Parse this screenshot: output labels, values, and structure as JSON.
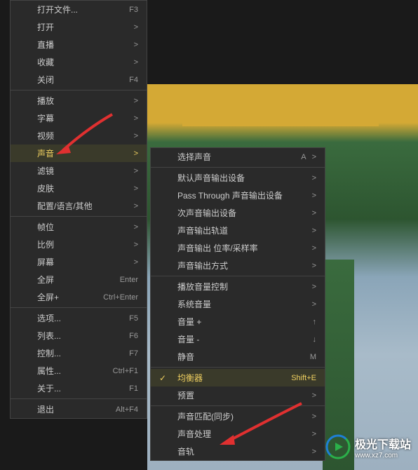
{
  "menu_left": {
    "groups": [
      [
        {
          "label": "打开文件...",
          "shortcut": "F3",
          "sub": false
        },
        {
          "label": "打开",
          "shortcut": "",
          "sub": true
        },
        {
          "label": "直播",
          "shortcut": "",
          "sub": true
        },
        {
          "label": "收藏",
          "shortcut": "",
          "sub": true
        },
        {
          "label": "关闭",
          "shortcut": "F4",
          "sub": false
        }
      ],
      [
        {
          "label": "播放",
          "shortcut": "",
          "sub": true
        },
        {
          "label": "字幕",
          "shortcut": "",
          "sub": true
        },
        {
          "label": "视频",
          "shortcut": "",
          "sub": true
        },
        {
          "label": "声音",
          "shortcut": "",
          "sub": true,
          "hl": true
        },
        {
          "label": "滤镜",
          "shortcut": "",
          "sub": true
        },
        {
          "label": "皮肤",
          "shortcut": "",
          "sub": true
        },
        {
          "label": "配置/语言/其他",
          "shortcut": "",
          "sub": true
        }
      ],
      [
        {
          "label": "帧位",
          "shortcut": "",
          "sub": true
        },
        {
          "label": "比例",
          "shortcut": "",
          "sub": true
        },
        {
          "label": "屏幕",
          "shortcut": "",
          "sub": true
        },
        {
          "label": "全屏",
          "shortcut": "Enter",
          "sub": false
        },
        {
          "label": "全屏+",
          "shortcut": "Ctrl+Enter",
          "sub": false
        }
      ],
      [
        {
          "label": "选项...",
          "shortcut": "F5",
          "sub": false
        },
        {
          "label": "列表...",
          "shortcut": "F6",
          "sub": false
        },
        {
          "label": "控制...",
          "shortcut": "F7",
          "sub": false
        },
        {
          "label": "属性...",
          "shortcut": "Ctrl+F1",
          "sub": false
        },
        {
          "label": "关于...",
          "shortcut": "F1",
          "sub": false
        }
      ],
      [
        {
          "label": "退出",
          "shortcut": "Alt+F4",
          "sub": false
        }
      ]
    ]
  },
  "menu_right": {
    "groups": [
      [
        {
          "label": "选择声音",
          "shortcut": "A",
          "sub": true
        }
      ],
      [
        {
          "label": "默认声音输出设备",
          "shortcut": "",
          "sub": true
        },
        {
          "label": "Pass Through 声音输出设备",
          "shortcut": "",
          "sub": true
        },
        {
          "label": "次声音输出设备",
          "shortcut": "",
          "sub": true
        },
        {
          "label": "声音输出轨道",
          "shortcut": "",
          "sub": true
        },
        {
          "label": "声音输出 位率/采样率",
          "shortcut": "",
          "sub": true
        },
        {
          "label": "声音输出方式",
          "shortcut": "",
          "sub": true
        }
      ],
      [
        {
          "label": "播放音量控制",
          "shortcut": "",
          "sub": true
        },
        {
          "label": "系统音量",
          "shortcut": "",
          "sub": true
        },
        {
          "label": "音量 +",
          "shortcut": "↑",
          "sub": false
        },
        {
          "label": "音量 -",
          "shortcut": "↓",
          "sub": false
        },
        {
          "label": "静音",
          "shortcut": "M",
          "sub": false
        }
      ],
      [
        {
          "label": "均衡器",
          "shortcut": "Shift+E",
          "sub": false,
          "hl": true,
          "check": true
        },
        {
          "label": "预置",
          "shortcut": "",
          "sub": true
        }
      ],
      [
        {
          "label": "声音匹配(同步)",
          "shortcut": "",
          "sub": true
        },
        {
          "label": "声音处理",
          "shortcut": "",
          "sub": true
        },
        {
          "label": "音轨",
          "shortcut": "",
          "sub": true
        }
      ]
    ]
  },
  "watermark": {
    "text": "极光下载站",
    "url": "www.xz7.com"
  }
}
